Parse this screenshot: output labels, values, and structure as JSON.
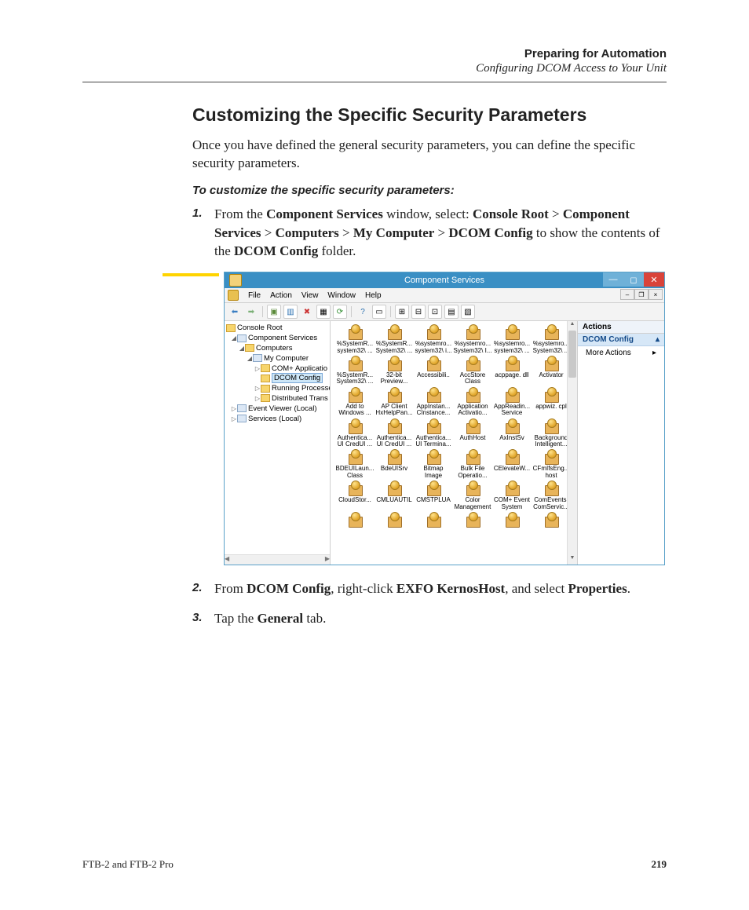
{
  "header": {
    "title": "Preparing for Automation",
    "subtitle": "Configuring DCOM Access to Your Unit"
  },
  "section_heading": "Customizing the Specific Security Parameters",
  "intro": "Once you have defined the general security parameters, you can define the specific security parameters.",
  "instr_head": "To customize the specific security parameters:",
  "steps": {
    "s1num": "1.",
    "s1a": "From the ",
    "s1b1": "Component Services",
    "s1c": " window, select: ",
    "s1b2": "Console Root",
    "gt": " > ",
    "s1b3": "Component Services",
    "s1b4": "Computers",
    "s1b5": "My Computer",
    "s1b6": "DCOM Config",
    "s1d": " to show the contents of the ",
    "s1b7": "DCOM Config",
    "s1e": " folder.",
    "s2num": "2.",
    "s2a": "From ",
    "s2b1": "DCOM Config",
    "s2c": ", right-click ",
    "s2b2": "EXFO KernosHost",
    "s2d": ", and select ",
    "s2b3": "Properties",
    "s2e": ".",
    "s3num": "3.",
    "s3a": "Tap the ",
    "s3b1": "General",
    "s3c": " tab."
  },
  "win": {
    "title": "Component Services",
    "menus": [
      "File",
      "Action",
      "View",
      "Window",
      "Help"
    ],
    "tree": {
      "root": "Console Root",
      "n1": "Component Services",
      "n2": "Computers",
      "n3": "My Computer",
      "n4": "COM+ Applicatio",
      "n5": "DCOM Config",
      "n6": "Running Processe",
      "n7": "Distributed Trans",
      "n8": "Event Viewer (Local)",
      "n9": "Services (Local)"
    },
    "actions": {
      "header": "Actions",
      "section": "DCOM Config",
      "item": "More Actions"
    },
    "items": [
      [
        {
          "l1": "%SystemR...",
          "l2": "system32\\ ..."
        },
        {
          "l1": "%SystemR...",
          "l2": "System32\\ ..."
        },
        {
          "l1": "%systemro...",
          "l2": "system32\\ i..."
        },
        {
          "l1": "%systemro...",
          "l2": "System32\\ I..."
        },
        {
          "l1": "%systemro...",
          "l2": "system32\\ ..."
        },
        {
          "l1": "%systemro...",
          "l2": "System32\\ ..."
        }
      ],
      [
        {
          "l1": "%SystemR...",
          "l2": "System32\\ ..."
        },
        {
          "l1": "32-bit",
          "l2": "Preview..."
        },
        {
          "l1": "Accessibili..",
          "l2": ""
        },
        {
          "l1": "AccStore",
          "l2": "Class"
        },
        {
          "l1": "acppage. dll",
          "l2": ""
        },
        {
          "l1": "Activator",
          "l2": ""
        }
      ],
      [
        {
          "l1": "Add to",
          "l2": "Windows ..."
        },
        {
          "l1": "AP Client",
          "l2": "HxHelpPan..."
        },
        {
          "l1": "AppInstan...",
          "l2": "CInstance..."
        },
        {
          "l1": "Application",
          "l2": "Activatio..."
        },
        {
          "l1": "AppReadin...",
          "l2": "Service"
        },
        {
          "l1": "appwiz. cpl",
          "l2": ""
        }
      ],
      [
        {
          "l1": "Authentica...",
          "l2": "UI CredUI ..."
        },
        {
          "l1": "Authentica...",
          "l2": "UI CredUI ..."
        },
        {
          "l1": "Authentica...",
          "l2": "UI Termina..."
        },
        {
          "l1": "AuthHost",
          "l2": ""
        },
        {
          "l1": "AxInstSv",
          "l2": ""
        },
        {
          "l1": "Background",
          "l2": "Intelligent..."
        }
      ],
      [
        {
          "l1": "BDEUILaun...",
          "l2": "Class"
        },
        {
          "l1": "BdeUISrv",
          "l2": ""
        },
        {
          "l1": "Bitmap",
          "l2": "Image"
        },
        {
          "l1": "Bulk File",
          "l2": "Operatio..."
        },
        {
          "l1": "CElevateW...",
          "l2": ""
        },
        {
          "l1": "CFmIfsEng...",
          "l2": "host"
        }
      ],
      [
        {
          "l1": "CloudStor...",
          "l2": ""
        },
        {
          "l1": "CMLUAUTIL",
          "l2": ""
        },
        {
          "l1": "CMSTPLUA",
          "l2": ""
        },
        {
          "l1": "Color",
          "l2": "Management"
        },
        {
          "l1": "COM+ Event",
          "l2": "System"
        },
        {
          "l1": "ComEvents.",
          "l2": "ComServic..."
        }
      ],
      [
        {
          "l1": "",
          "l2": ""
        },
        {
          "l1": "",
          "l2": ""
        },
        {
          "l1": "",
          "l2": ""
        },
        {
          "l1": "",
          "l2": ""
        },
        {
          "l1": "",
          "l2": ""
        },
        {
          "l1": "",
          "l2": ""
        }
      ]
    ]
  },
  "footer": {
    "left": "FTB-2 and FTB-2 Pro",
    "page": "219"
  }
}
